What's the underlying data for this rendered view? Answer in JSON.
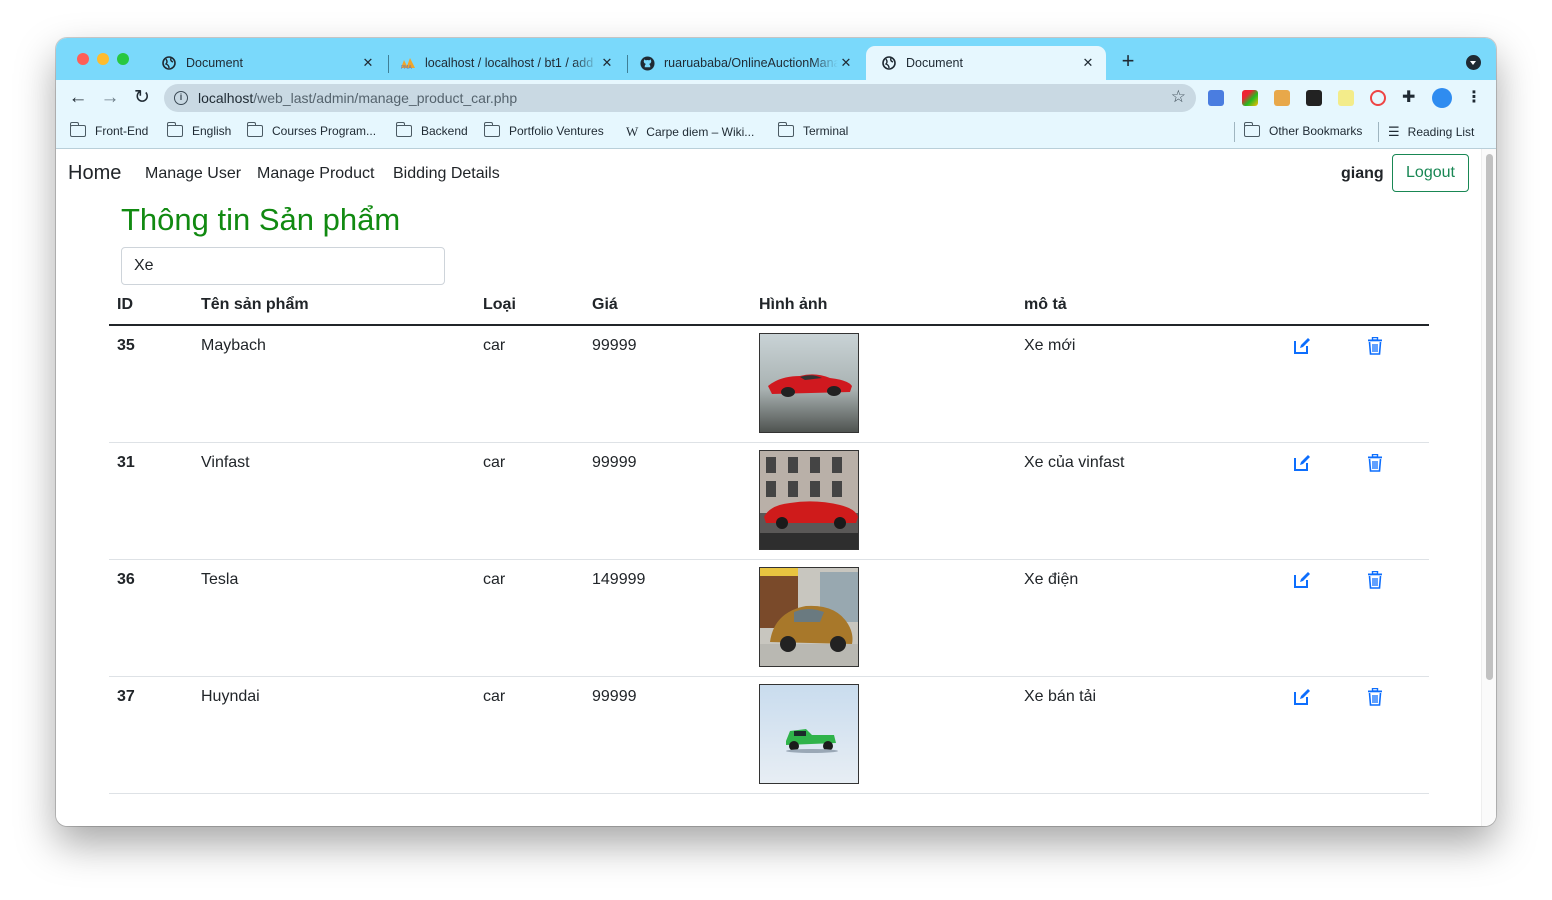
{
  "browser": {
    "tabs": [
      {
        "title": "Document",
        "icon": "globe-icon"
      },
      {
        "title": "localhost / localhost / bt1 / add",
        "icon": "phpmyadmin-icon"
      },
      {
        "title": "ruaruababa/OnlineAuctionMana",
        "icon": "github-icon"
      },
      {
        "title": "Document",
        "icon": "globe-icon",
        "active": true
      }
    ],
    "url_host": "localhost",
    "url_path": "/web_last/admin/manage_product_car.php",
    "bookmarks": [
      {
        "label": "Front-End",
        "icon": "folder-icon"
      },
      {
        "label": "English",
        "icon": "folder-icon"
      },
      {
        "label": "Courses Program...",
        "icon": "folder-icon"
      },
      {
        "label": "Backend",
        "icon": "folder-icon"
      },
      {
        "label": "Portfolio Ventures",
        "icon": "folder-icon"
      },
      {
        "label": "Carpe diem – Wiki...",
        "icon": "wikipedia-icon"
      },
      {
        "label": "Terminal",
        "icon": "folder-icon"
      }
    ],
    "other_bookmarks": "Other Bookmarks",
    "reading_list": "Reading List"
  },
  "navbar": {
    "brand": "Home",
    "links": [
      "Manage User",
      "Manage Product",
      "Bidding Details"
    ],
    "username": "giang",
    "logout": "Logout"
  },
  "page": {
    "title": "Thông tin Sản phẩm",
    "search_value": "Xe"
  },
  "table": {
    "headers": [
      "ID",
      "Tên sản phẩm",
      "Loại",
      "Giá",
      "Hình ảnh",
      "mô tả"
    ],
    "rows": [
      {
        "id": "35",
        "name": "Maybach",
        "type": "car",
        "price": "99999",
        "image": "red-sports-car-photo",
        "desc": "Xe mới"
      },
      {
        "id": "31",
        "name": "Vinfast",
        "type": "car",
        "price": "99999",
        "image": "red-car-building-photo",
        "desc": "Xe của vinfast"
      },
      {
        "id": "36",
        "name": "Tesla",
        "type": "car",
        "price": "149999",
        "image": "vintage-beetle-photo",
        "desc": "Xe điện"
      },
      {
        "id": "37",
        "name": "Huyndai",
        "type": "car",
        "price": "99999",
        "image": "green-truck-photo",
        "desc": "Xe bán tải"
      }
    ]
  },
  "colors": {
    "title_green": "#118a11",
    "logout_green": "#198754",
    "action_blue": "#0d6efd",
    "tab_bar": "#7ad9fb"
  }
}
